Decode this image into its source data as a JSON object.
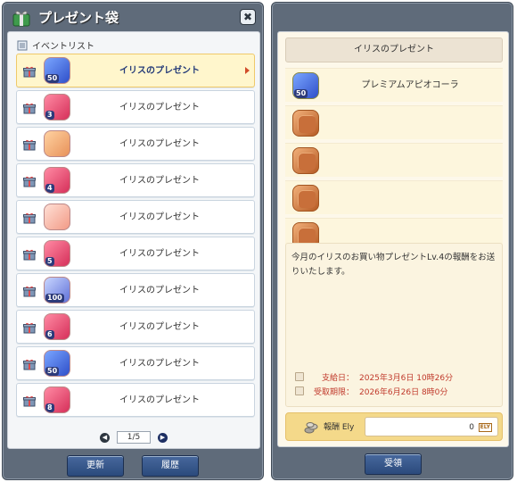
{
  "left_window": {
    "title": "プレゼント袋",
    "close_label": "✖",
    "list_header": "イベントリスト",
    "rows": [
      {
        "label": "イリスのプレゼント",
        "badge": "50",
        "selected": true
      },
      {
        "label": "イリスのプレゼント",
        "badge": "3"
      },
      {
        "label": "イリスのプレゼント",
        "badge": ""
      },
      {
        "label": "イリスのプレゼント",
        "badge": "4"
      },
      {
        "label": "イリスのプレゼント",
        "badge": ""
      },
      {
        "label": "イリスのプレゼント",
        "badge": "5"
      },
      {
        "label": "イリスのプレゼント",
        "badge": "100"
      },
      {
        "label": "イリスのプレゼント",
        "badge": "6"
      },
      {
        "label": "イリスのプレゼント",
        "badge": "50"
      },
      {
        "label": "イリスのプレゼント",
        "badge": "8"
      }
    ],
    "pager": {
      "page": "1/5",
      "prev_label": "◀",
      "next_label": "▶"
    },
    "buttons": {
      "update": "更新",
      "history": "履歴"
    }
  },
  "right_window": {
    "header": "イリスのプレゼント",
    "slots": [
      {
        "label": "プレミアムアピオコーラ",
        "badge": "50"
      },
      {
        "label": ""
      },
      {
        "label": ""
      },
      {
        "label": ""
      },
      {
        "label": ""
      }
    ],
    "message": "今月のイリスのお買い物プレゼントLv.4の報酬をお送りいたします。",
    "info": {
      "supply_label": "支給日：",
      "supply_value": "2025年3月6日 10時26分",
      "deadline_label": "受取期限：",
      "deadline_value": "2026年6月26日 8時0分"
    },
    "reward": {
      "label": "報酬 Ely",
      "amount": "0",
      "unit": "ELY"
    },
    "buttons": {
      "receive": "受領"
    }
  },
  "colors": {
    "window_frame": "#5f6b7a",
    "selected_row": "#fff6cc",
    "button": "#2b4a7c",
    "date_text": "#c0392b",
    "reward_bar": "#f4d98a"
  }
}
